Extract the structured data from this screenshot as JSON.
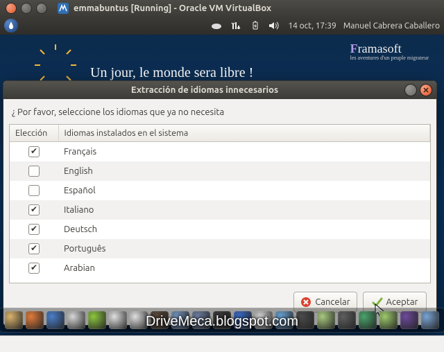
{
  "host": {
    "title": "emmabuntus [Running] - Oracle VM VirtualBox"
  },
  "panel": {
    "datetime": "14 oct, 17:39",
    "user": "Manuel Cabrera Caballero"
  },
  "desktop": {
    "logo_main": "Framasoft",
    "logo_sub": "les aventures d'un peuple migrateur",
    "tagline": "Un jour, le monde sera libre !"
  },
  "dialog": {
    "title": "Extracción de idiomas innecesarios",
    "prompt": "¿ Por favor, seleccione los idiomas que ya no necesita",
    "col_choice": "Elección",
    "col_lang": "Idiomas instalados en el sistema",
    "rows": [
      {
        "checked": true,
        "label": "Français"
      },
      {
        "checked": false,
        "label": "English"
      },
      {
        "checked": false,
        "label": "Español"
      },
      {
        "checked": true,
        "label": "Italiano"
      },
      {
        "checked": true,
        "label": "Deutsch"
      },
      {
        "checked": true,
        "label": "Português"
      },
      {
        "checked": true,
        "label": "Arabian"
      }
    ],
    "cancel": "Cancelar",
    "accept": "Aceptar"
  },
  "watermark": "DriveMeca.blogspot.com",
  "dock_colors": [
    "#d9b36b",
    "#e07b3a",
    "#4a7ec8",
    "#d7d7d7",
    "#8cc63f",
    "#e0e0e0",
    "#e0e0e0",
    "#5a4a3a",
    "#7797c4",
    "#6e7fa3",
    "#3a3a3a",
    "#3a6bc7",
    "#d7d7d7",
    "#6aa3d4",
    "#4a4a4a",
    "#a8c97f",
    "#5e5e5e",
    "#4aa36b",
    "#9cc96b",
    "#6e4a9c",
    "#7aa3d4"
  ]
}
